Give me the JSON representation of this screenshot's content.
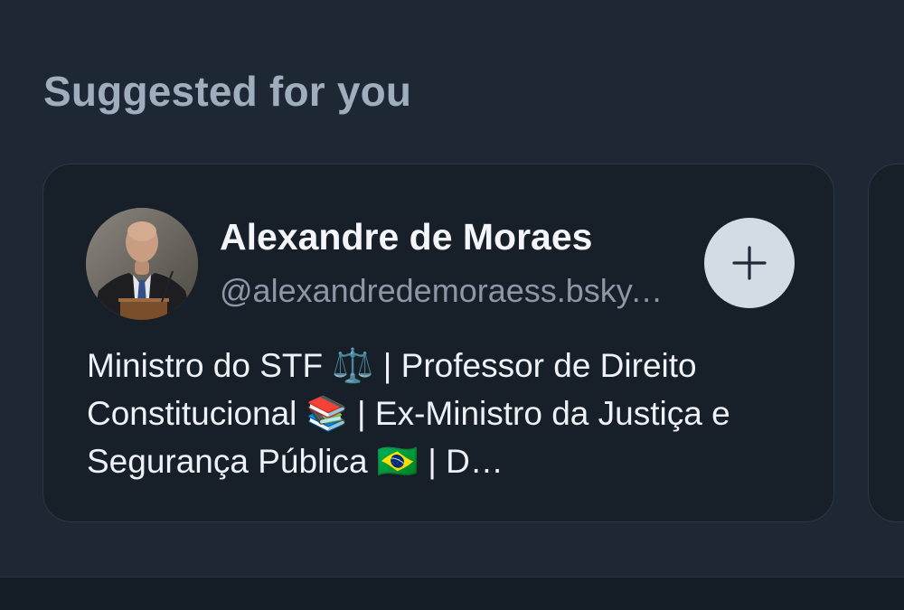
{
  "section": {
    "title": "Suggested for you"
  },
  "suggestion": {
    "name": "Alexandre de Moraes",
    "handle": "@alexandredemoraess.bsky.social",
    "bio": "Ministro do STF ⚖️ | Professor de Direito Constitucional 📚 | Ex-Ministro da Justiça e Segurança Pública 🇧🇷 | D…",
    "follow_icon": "plus-icon",
    "avatar_icon": "profile-photo"
  },
  "colors": {
    "background": "#1e2834",
    "card": "#171f29",
    "follow_button": "#d3dbe5",
    "title": "#9fadbd"
  }
}
